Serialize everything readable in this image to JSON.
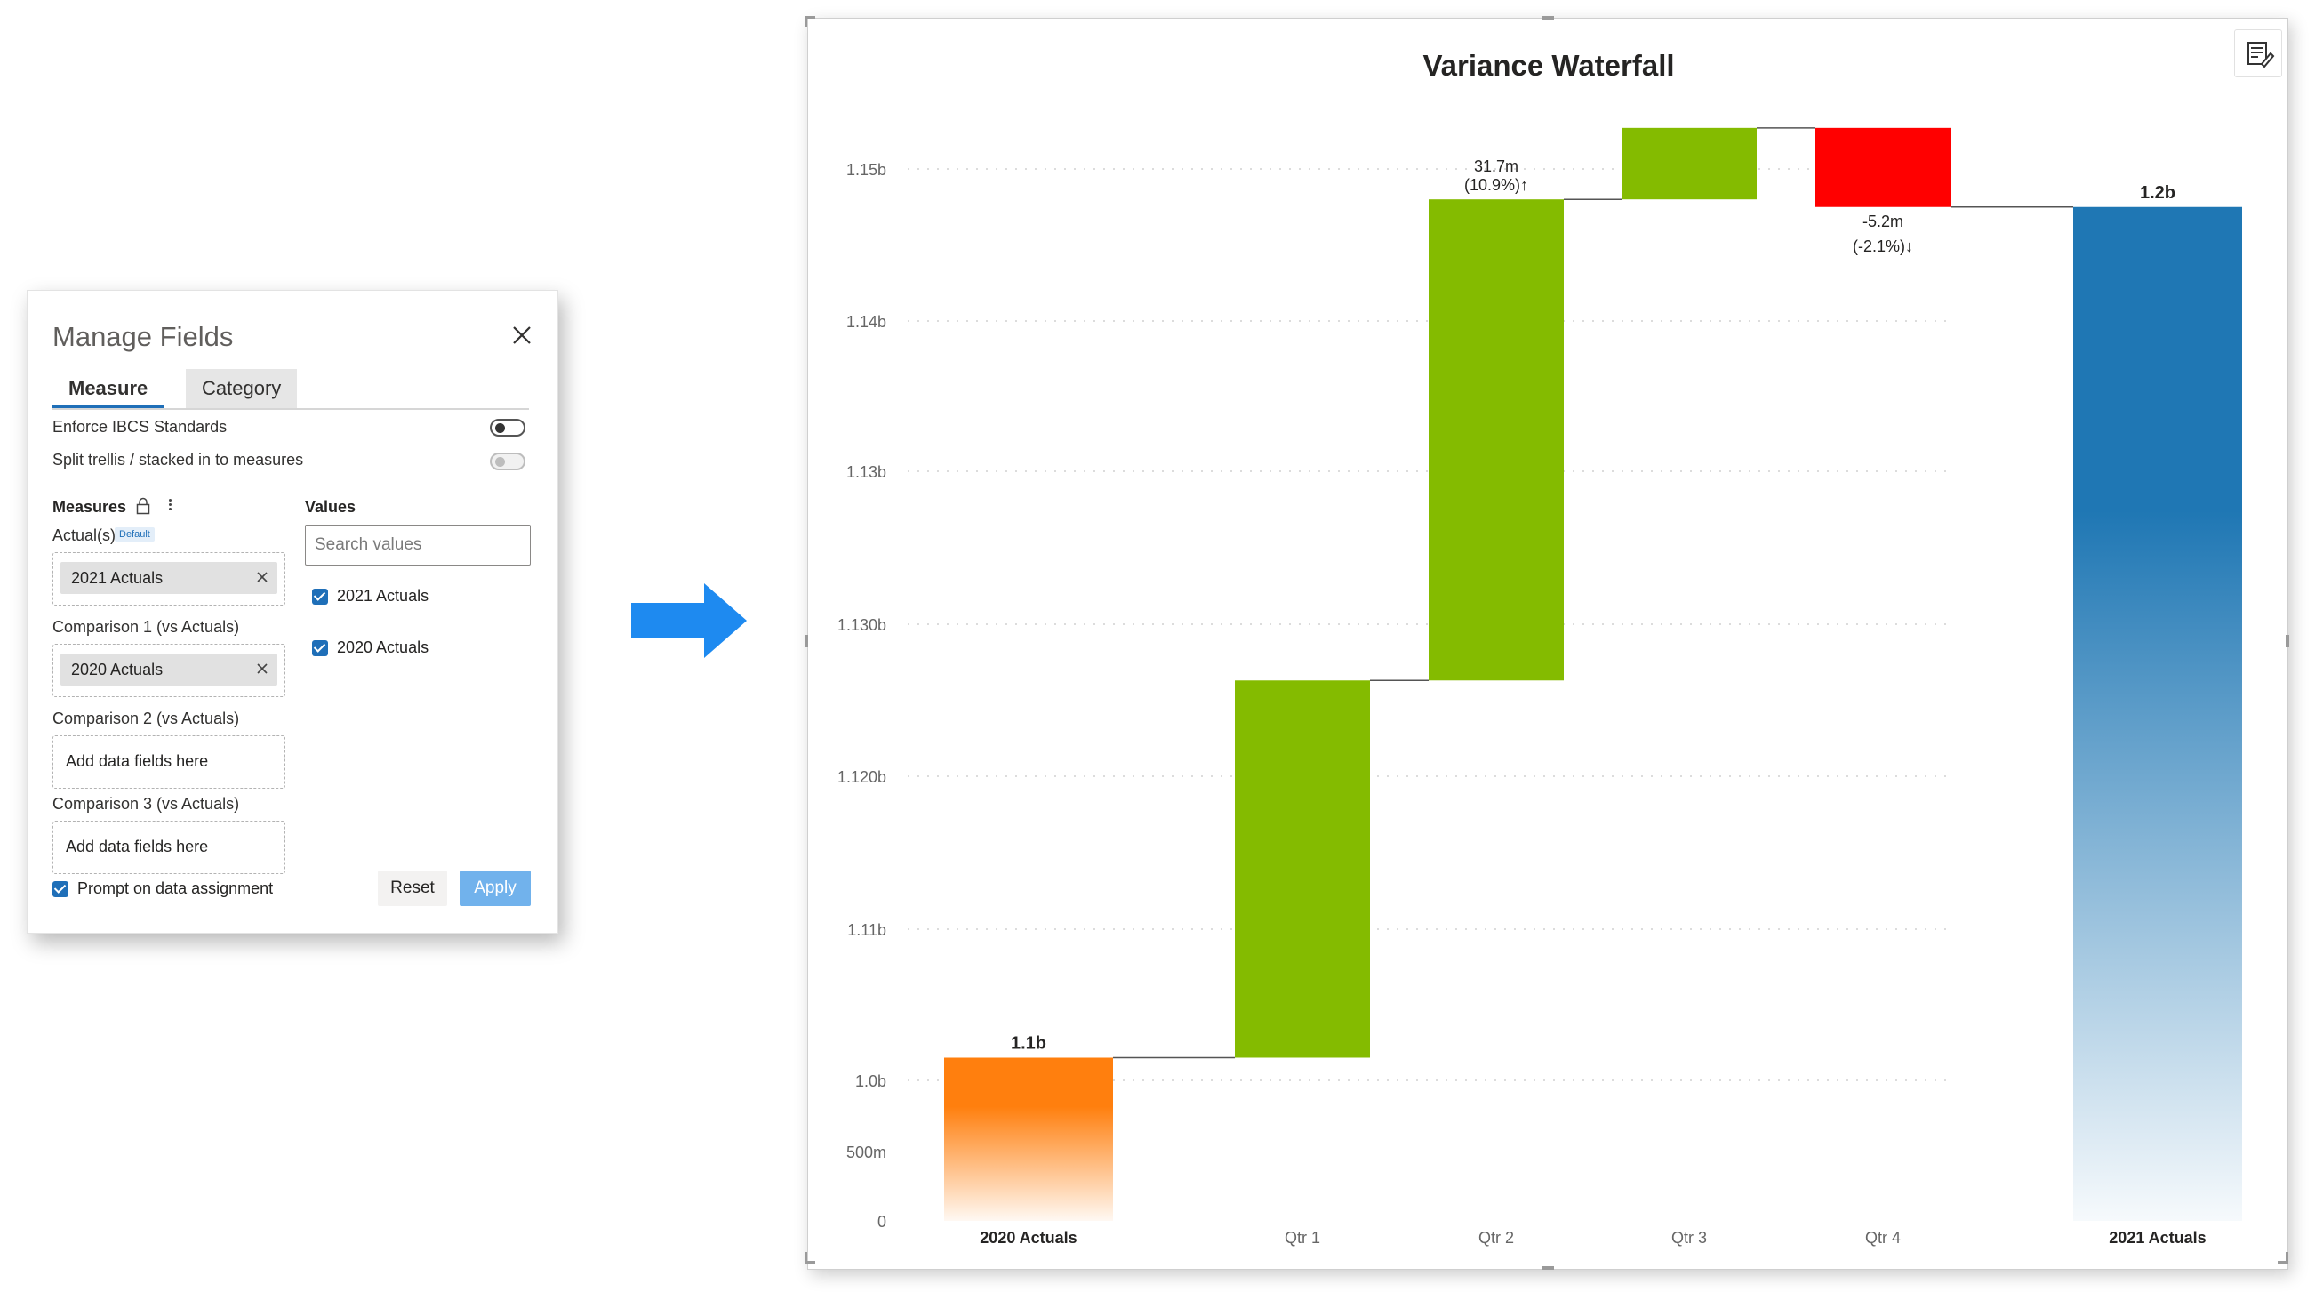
{
  "dialog": {
    "title": "Manage Fields",
    "tabs": [
      "Measure",
      "Category"
    ],
    "toggles": [
      {
        "label": "Enforce IBCS Standards",
        "on": false,
        "enabled": true
      },
      {
        "label": "Split trellis / stacked in to measures",
        "on": false,
        "enabled": false
      }
    ],
    "measures_header": "Measures",
    "values_header": "Values",
    "actuals_label": "Actual(s)",
    "default_badge": "Default",
    "actual_chip": "2021 Actuals",
    "comparison1_label": "Comparison 1 (vs Actuals)",
    "comparison1_chip": "2020 Actuals",
    "comparison2_label": "Comparison 2 (vs Actuals)",
    "comparison2_placeholder": "Add data fields here",
    "comparison3_label": "Comparison 3 (vs Actuals)",
    "comparison3_placeholder": "Add data fields here",
    "search_placeholder": "Search values",
    "values": [
      {
        "label": "2021 Actuals",
        "checked": true
      },
      {
        "label": "2020 Actuals",
        "checked": true
      }
    ],
    "prompt_label": "Prompt on data assignment",
    "prompt_checked": true,
    "reset_label": "Reset",
    "apply_label": "Apply"
  },
  "colors": {
    "accent": "#1f6fb8",
    "arrow": "#1e8af0",
    "increase": "#84bb00",
    "decrease": "#ff0000",
    "actual_2020": "#ff7f0e",
    "actual_2021": "#1f77b4"
  },
  "icons": {
    "close": "close-icon",
    "lock": "lock-icon",
    "more": "more-vertical-icon",
    "arrow": "right-arrow-icon",
    "format": "format-pane-icon"
  },
  "chart_data": {
    "type": "waterfall",
    "title": "Variance Waterfall",
    "categories": [
      "2020 Actuals",
      "Qtr 1",
      "Qtr 2",
      "Qtr 3",
      "Qtr 4",
      "2021 Actuals"
    ],
    "bars": [
      {
        "category": "2020 Actuals",
        "kind": "total",
        "start": 0,
        "end": 1.1015
      },
      {
        "category": "Qtr 1",
        "kind": "increase",
        "start": 1.1015,
        "end": 1.1263
      },
      {
        "category": "Qtr 2",
        "kind": "increase",
        "start": 1.1263,
        "end": 1.158
      },
      {
        "category": "Qtr 3",
        "kind": "increase",
        "start": 1.158,
        "end": 1.1627
      },
      {
        "category": "Qtr 4",
        "kind": "decrease",
        "start": 1.1627,
        "end": 1.1575
      },
      {
        "category": "2021 Actuals",
        "kind": "total",
        "start": 0,
        "end": 1.1575
      }
    ],
    "data_labels": [
      {
        "category": "2020 Actuals",
        "lines": [
          "1.1b"
        ],
        "bold": true
      },
      {
        "category": "Qtr 2",
        "lines": [
          "31.7m",
          "(10.9%)↑"
        ],
        "bold": false
      },
      {
        "category": "Qtr 4",
        "lines": [
          "-5.2m",
          "(-2.1%)↓"
        ],
        "bold": false
      },
      {
        "category": "2021 Actuals",
        "lines": [
          "1.2b"
        ],
        "bold": true
      }
    ],
    "y_ticks": [
      {
        "label": "0",
        "value": 0
      },
      {
        "label": "500m",
        "value": 0.5
      },
      {
        "label": "1.0b",
        "value": 1.1
      },
      {
        "label": "1.11b",
        "value": 1.11
      },
      {
        "label": "1.120b",
        "value": 1.12
      },
      {
        "label": "1.130b",
        "value": 1.13
      },
      {
        "label": "1.13b",
        "value": 1.14
      },
      {
        "label": "1.14b",
        "value": 1.15
      },
      {
        "label": "1.15b",
        "value": 1.16
      }
    ],
    "axis_break": true,
    "grid": true
  }
}
